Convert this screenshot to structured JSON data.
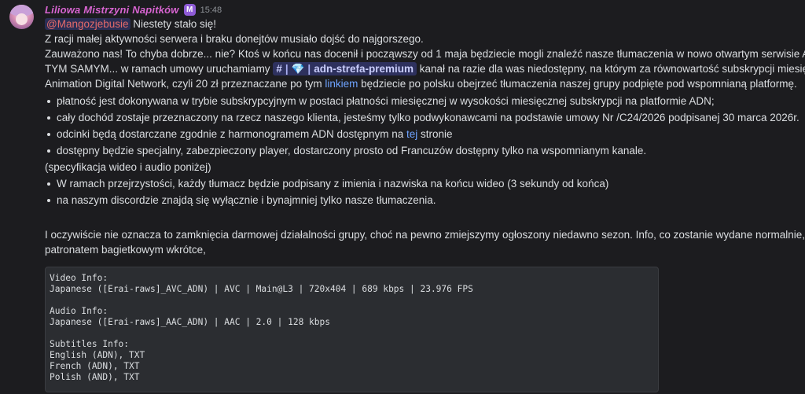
{
  "user": {
    "name": "Liliowa Mistrzyni Napitków",
    "badge": "M",
    "timestamp": "15:48"
  },
  "message": {
    "mention": "@Mangozjebusie",
    "line1_rest": " Niestety stało się!",
    "line2": "Z racji małej aktywności serwera i braku donejtów musiało dojść do najgorszego.",
    "line3": "Zauważono nas! To chyba dobrze... nie? Ktoś w końcu nas docenił i począwszy od 1 maja będziecie mogli znaleźć nasze tłumaczenia w nowo otwartym serwisie ADN...",
    "line4_before": "TYM SAMYM... w ramach umowy uruchamiamy ",
    "channel_hash": "#",
    "channel_sep": "|",
    "channel_icon": "💎",
    "channel_name": "adn-strefa-premium",
    "line4_after": " kanał na razie dla was niedostępny, na którym za równowartość subskrypcji miesięcznej",
    "line5_before": "Animation Digital Network, czyli 20 zł przeznaczane po tym ",
    "line5_link": "linkiem",
    "line5_after": " będziecie po polsku obejrzeć tłumaczenia naszej grupy podpięte pod wspomnianą platformę.",
    "bullets_1": [
      {
        "text": "płatność jest dokonywana w trybie subskrypcyjnym w postaci płatności miesięcznej w wysokości miesięcznej subskrypcji na platformie ADN;"
      },
      {
        "text": "cały dochód zostaje przeznaczony na rzecz naszego klienta, jesteśmy tylko podwykonawcami na podstawie umowy Nr /C24/2026 podpisanej 30 marca 2026r."
      },
      {
        "before": "odcinki będą dostarczane zgodnie z harmonogramem ADN dostępnym na ",
        "link": "tej",
        "after": " stronie"
      },
      {
        "text": "dostępny będzie specjalny, zabezpieczony player, dostarczony prosto od Francuzów dostępny tylko na wspomnianym kanale."
      }
    ],
    "spec_note": "(specyfikacja wideo i audio poniżej)",
    "bullets_2": [
      "W ramach przejrzystości, każdy tłumacz będzie podpisany z imienia i nazwiska na końcu wideo (3 sekundy od końca)",
      "na naszym discordzie znajdą się wyłącznie i bynajmniej tylko nasze tłumaczenia."
    ],
    "closing_1": "I oczywiście nie oznacza to zamknięcia darmowej działalności grupy, choć na pewno zmiejszymy ogłoszony niedawno sezon. Info, co zostanie wydane normalnie, a co za",
    "closing_2": "patronatem bagietkowym wkrótce,"
  },
  "code": [
    "Video Info:",
    "Japanese ([Erai-raws]_AVC_ADN) | AVC | Main@L3 | 720x404 | 689 kbps | 23.976 FPS",
    "",
    "Audio Info:",
    "Japanese ([Erai-raws]_AAC_ADN) | AAC | 2.0 | 128 kbps",
    "",
    "Subtitles Info:",
    "English (ADN), TXT",
    "French (ADN), TXT",
    "Polish (AND), TXT"
  ]
}
